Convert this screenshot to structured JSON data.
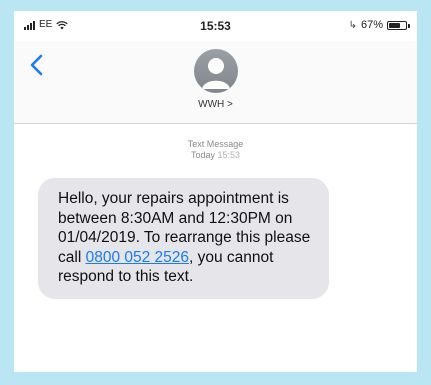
{
  "status_bar": {
    "carrier": "EE",
    "time": "15:53",
    "battery_percent": "67%",
    "battery_level": 0.67
  },
  "header": {
    "contact_name": "WWH >"
  },
  "thread": {
    "message_type": "Text Message",
    "date_label": "Today",
    "time_label": "15:53"
  },
  "message": {
    "text_before": "Hello, your repairs appointment is between 8:30AM and 12:30PM on 01/04/2019. To rearrange this please call ",
    "phone_link": "0800 052 2526",
    "text_after": ", you cannot respond to this text."
  },
  "colors": {
    "background": "#b9e6f2",
    "accent": "#1a7cf0",
    "bubble": "#e5e5ea"
  },
  "icons": [
    "signal-icon",
    "wifi-icon",
    "charging-icon",
    "battery-icon",
    "back-chevron-icon",
    "avatar-icon"
  ]
}
